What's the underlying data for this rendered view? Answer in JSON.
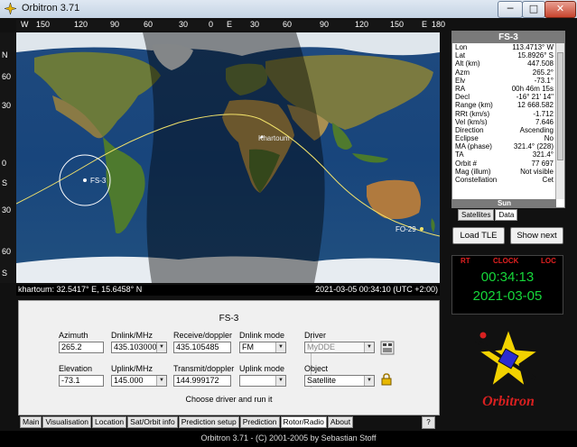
{
  "window": {
    "title": "Orbitron 3.71",
    "min_glyph": "─",
    "max_glyph": "□",
    "close_glyph": "✕"
  },
  "lon_scale": [
    "W",
    "150",
    "120",
    "90",
    "60",
    "30",
    "0",
    "E",
    "30",
    "60",
    "90",
    "120",
    "150",
    "E",
    "180"
  ],
  "lat_scale": [
    "N",
    "60",
    "30",
    "0",
    "S",
    "30",
    "60",
    "S"
  ],
  "map": {
    "satellites": [
      {
        "name": "FS-3"
      },
      {
        "name": "FO-29"
      }
    ],
    "cities": [
      {
        "name": "Khartoum"
      }
    ],
    "status_left": "khartoum: 32.5417° E, 15.6458° N",
    "status_right": "2021-03-05 00:34:10 (UTC +2:00)"
  },
  "info_panel": {
    "header": "FS-3",
    "rows": [
      {
        "k": "Lon",
        "v": "113.4713° W"
      },
      {
        "k": "Lat",
        "v": "15.8926° S"
      },
      {
        "k": "Alt (km)",
        "v": "447.508"
      },
      {
        "k": "Azm",
        "v": "265.2°"
      },
      {
        "k": "Elv",
        "v": "-73.1°"
      },
      {
        "k": "RA",
        "v": "00h 46m 15s"
      },
      {
        "k": "Decl",
        "v": "-16° 21' 14\""
      },
      {
        "k": "Range (km)",
        "v": "12 668.582"
      },
      {
        "k": "RRt (km/s)",
        "v": "-1.712"
      },
      {
        "k": "Vel (km/s)",
        "v": "7.646"
      },
      {
        "k": "Direction",
        "v": "Ascending"
      },
      {
        "k": "Eclipse",
        "v": "No"
      },
      {
        "k": "MA (phase)",
        "v": "321.4° (228)"
      },
      {
        "k": "TA",
        "v": "321.4°"
      },
      {
        "k": "Orbit #",
        "v": "77 697"
      },
      {
        "k": "Mag (illum)",
        "v": "Not visible"
      },
      {
        "k": "Constellation",
        "v": "Cet"
      }
    ],
    "sun_header": "Sun",
    "tabs": [
      "Satellites",
      "Data"
    ]
  },
  "buttons": {
    "load_tle": "Load TLE",
    "show_next": "Show next"
  },
  "clock": {
    "rt": "RT",
    "clock": "CLOCK",
    "loc": "LOC",
    "time": "00:34:13",
    "date": "2021-03-05"
  },
  "logo_text": "Orbitron",
  "rotor": {
    "title": "FS-3",
    "azimuth_label": "Azimuth",
    "azimuth_value": "265.2",
    "dnlink_label": "Dnlink/MHz",
    "dnlink_value": "435.103000",
    "receive_label": "Receive/doppler",
    "receive_value": "435.105485",
    "dnmode_label": "Dnlink mode",
    "dnmode_value": "FM",
    "driver_label": "Driver",
    "driver_value": "MyDDE",
    "elevation_label": "Elevation",
    "elevation_value": "-73.1",
    "uplink_label": "Uplink/MHz",
    "uplink_value": "145.000",
    "transmit_label": "Transmit/doppler",
    "transmit_value": "144.999172",
    "upmode_label": "Uplink mode",
    "upmode_value": "",
    "object_label": "Object",
    "object_value": "Satellite",
    "hint": "Choose driver and run it"
  },
  "bottom_tabs": [
    "Main",
    "Visualisation",
    "Location",
    "Sat/Orbit info",
    "Prediction setup",
    "Prediction",
    "Rotor/Radio",
    "About"
  ],
  "help_glyph": "?",
  "footer": "Orbitron 3.71 - (C) 2001-2005 by Sebastian Stoff"
}
